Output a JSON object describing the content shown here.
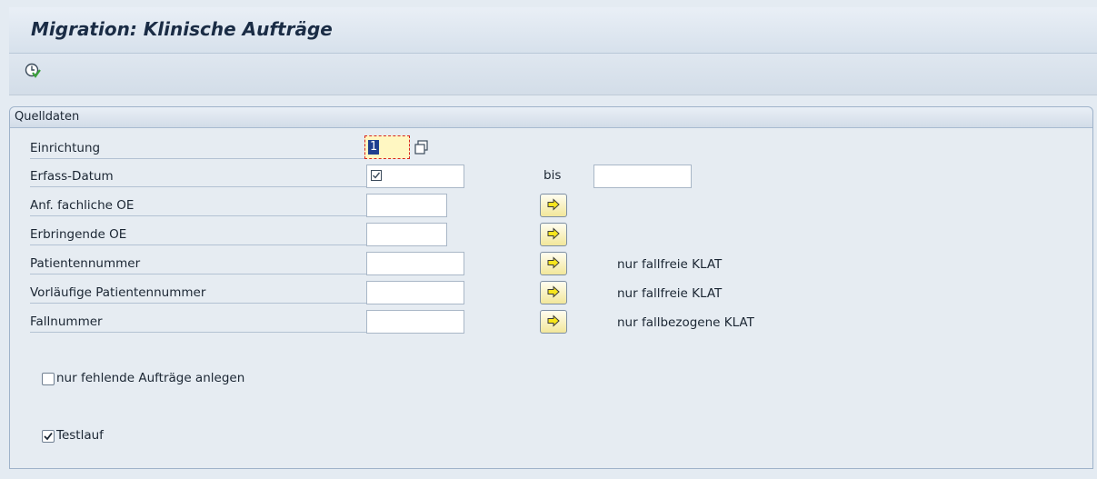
{
  "app": {
    "title": "Migration: Klinische Aufträge"
  },
  "toolbar": {
    "execute_icon": "execute-clock-icon"
  },
  "group": {
    "title": "Quelldaten",
    "fields": [
      {
        "label": "Einrichtung",
        "value": "1"
      },
      {
        "label": "Erfass-Datum",
        "value": "",
        "to_label": "bis",
        "to_value": ""
      },
      {
        "label": "Anf. fachliche OE",
        "value": ""
      },
      {
        "label": "Erbringende OE",
        "value": ""
      },
      {
        "label": "Patientennummer",
        "value": "",
        "note": "nur fallfreie KLAT"
      },
      {
        "label": "Vorläufige Patientennummer",
        "value": "",
        "note": "nur fallfreie KLAT"
      },
      {
        "label": "Fallnummer",
        "value": "",
        "note": "nur fallbezogene KLAT"
      }
    ]
  },
  "options": {
    "missing_orders": {
      "label": "nur fehlende Aufträge anlegen",
      "checked": false
    },
    "test_run": {
      "label": "Testlauf",
      "checked": true
    }
  },
  "colors": {
    "accent_yellow": "#f2e79a",
    "background": "#e4ebf2"
  }
}
